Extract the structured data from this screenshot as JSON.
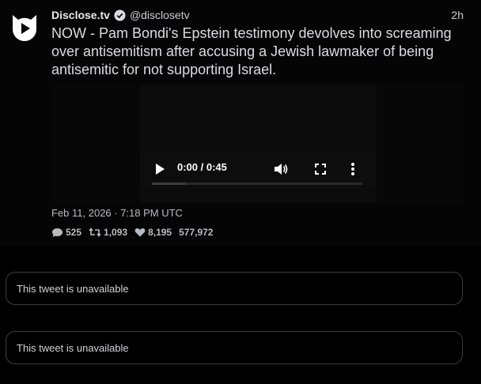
{
  "tweet": {
    "author_name": "Disclose.tv",
    "handle": "@disclosetv",
    "relative_time": "2h",
    "text": "NOW - Pam Bondi's Epstein testimony devolves into screaming over antisemitism after accusing a Jewish lawmaker of being antisemitic for not supporting Israel.",
    "avatar_icon": "disclose-logo-icon",
    "verified_icon": "verified-badge-icon",
    "video": {
      "time_display": "0:00 / 0:45",
      "progress": 0.16
    },
    "date": "Feb 11, 2026 · 7:18 PM UTC",
    "stats": {
      "replies": "525",
      "retweets": "1,093",
      "likes": "8,195",
      "views": "577,972"
    }
  },
  "unavailable_tweets": [
    {
      "text": "This tweet is unavailable"
    },
    {
      "text": "This tweet is unavailable"
    }
  ],
  "colors": {
    "background": "#000000",
    "tweet_background": "#050505",
    "text": "#d9dde0",
    "muted": "#b7bcc0",
    "border": "#3a3d40"
  }
}
